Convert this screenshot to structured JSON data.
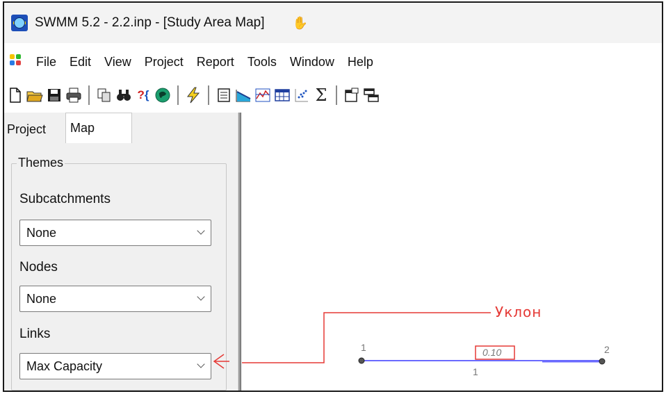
{
  "window": {
    "title": "SWMM 5.2 - 2.2.inp - [Study Area Map]"
  },
  "menu": {
    "items": [
      "File",
      "Edit",
      "View",
      "Project",
      "Report",
      "Tools",
      "Window",
      "Help"
    ]
  },
  "toolbar": {
    "icons": [
      "new-file-icon",
      "open-folder-icon",
      "save-icon",
      "print-icon",
      "copy-icon",
      "find-icon",
      "query-icon",
      "overview-map-icon",
      "run-icon",
      "status-report-icon",
      "profile-plot-icon",
      "time-series-plot-icon",
      "table-icon",
      "scatter-plot-icon",
      "statistics-icon",
      "options-icon",
      "arrange-windows-icon"
    ]
  },
  "panel": {
    "tabs": {
      "project": "Project",
      "map": "Map"
    },
    "themes": {
      "label": "Themes",
      "subcatchments": {
        "label": "Subcatchments",
        "value": "None"
      },
      "nodes": {
        "label": "Nodes",
        "value": "None"
      },
      "links": {
        "label": "Links",
        "value": "Max Capacity"
      }
    }
  },
  "map": {
    "node_start_label": "1",
    "node_end_label": "2",
    "link_label": "1",
    "link_value": "0.10",
    "annotation": "Уклон"
  },
  "colors": {
    "annotation": "#e53935",
    "link": "#6a6aff",
    "node": "#555555",
    "title_bar": "#f3f3f3",
    "panel": "#f0f0f0"
  }
}
